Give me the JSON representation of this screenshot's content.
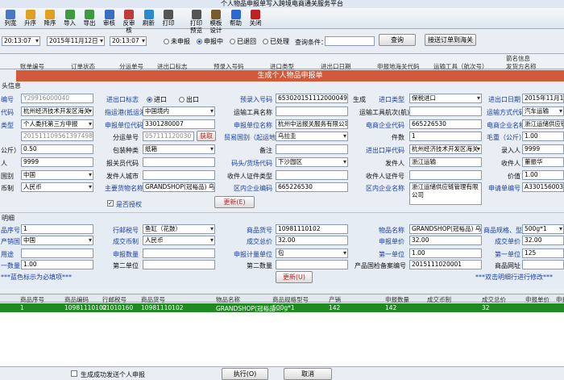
{
  "window": {
    "title": "个人物品申报单写入跨境电商通关服务平台"
  },
  "toolbar": [
    {
      "label": "列宽",
      "icon": "column-width-icon",
      "color": "#4a78c2"
    },
    {
      "label": "升序",
      "icon": "sort-asc-icon",
      "color": "#e0a020"
    },
    {
      "label": "降序",
      "icon": "sort-desc-icon",
      "color": "#e0a020"
    },
    {
      "label": "导入",
      "icon": "import-icon",
      "color": "#3f9a3f"
    },
    {
      "label": "导出",
      "icon": "export-icon",
      "color": "#3f9a3f"
    },
    {
      "label": "审核",
      "icon": "audit-icon",
      "color": "#3a6fc0"
    },
    {
      "label": "反审核",
      "icon": "unaudit-icon",
      "color": "#c03a3a"
    },
    {
      "label": "刷新",
      "icon": "refresh-icon",
      "color": "#2a8ad0"
    },
    {
      "label": "打印",
      "icon": "print-icon",
      "color": "#555"
    },
    {
      "label": "打印预览",
      "icon": "print-preview-icon",
      "color": "#555"
    },
    {
      "label": "模板设计",
      "icon": "template-design-icon",
      "color": "#7a5a2a"
    },
    {
      "label": "帮助",
      "icon": "help-icon",
      "color": "#2a6ad0"
    },
    {
      "label": "关闭",
      "icon": "close-icon",
      "color": "#c02020"
    }
  ],
  "filter": {
    "time1": "20:13:07",
    "date2": "2015年11月12日",
    "time2": "20:13:07",
    "radios": [
      "未申报",
      "申报中",
      "已退回",
      "已处理"
    ],
    "radio_selected": 1,
    "query_label": "查询条件：",
    "query_value": "",
    "query_button": "查询",
    "send_button": "接送订单到海关"
  },
  "grid1": {
    "group_label": "箭名信息",
    "headers": [
      "账单编号",
      "订单状态",
      "分运单号",
      "进出口标志",
      "预录入号码",
      "进口类型",
      "进出口日期",
      "申报地海关代码",
      "运输工具（航次号）",
      "发货方名称"
    ]
  },
  "modal": {
    "title": "生成个人物品申报单"
  },
  "sec1": {
    "heading": "头信息",
    "left": [
      {
        "label": "编号",
        "value": "Y29916000040",
        "gray": true
      },
      {
        "label": "代码",
        "value": "杭州经济技术开发区海关",
        "select": true
      },
      {
        "label": "类型",
        "value": "个人委托第三方申报",
        "select": true
      },
      {
        "label": "",
        "value": "201511109561397498I",
        "gray": true
      },
      {
        "label": "公斤）",
        "value": "0.50"
      },
      {
        "label": "人",
        "value": "9999"
      },
      {
        "label": "国别",
        "value": "中国",
        "select": true
      },
      {
        "label": "币制",
        "value": "人民币",
        "select": true
      }
    ],
    "mid_labels": [
      "进出口标志",
      "指运港(抵运港)",
      "申报单位代码",
      "分运单号",
      "包装种类",
      "报关员代码",
      "发件人城市",
      "主要货物名称"
    ],
    "mid_values": [
      {
        "value": ""
      },
      {
        "value": "中国境内",
        "select": true
      },
      {
        "value": "3301280007"
      },
      {
        "value": "057111120030",
        "gray": true
      },
      {
        "value": "纸箱",
        "select": true
      },
      {
        "value": ""
      },
      {
        "value": ""
      },
      {
        "value": "GRANDSHOP(冠裕品) 乌拉圭"
      }
    ],
    "io_radios": [
      "进口",
      "出口"
    ],
    "get_button": "获取",
    "authorize_label": "是否授权",
    "r1_labels": [
      "预录入号码",
      "运输工具名称",
      "申报单位名称",
      "贸易国别（起运地）",
      "备注",
      "码头/货场代码",
      "收件人证件类型",
      "区内企业编码"
    ],
    "r1_values": [
      {
        "value": "653020151112000049"
      },
      {
        "value": ""
      },
      {
        "value": "杭州中远报关服务有限公司"
      },
      {
        "value": "乌拉圭",
        "select": true
      },
      {
        "value": ""
      },
      {
        "value": "下沙园区",
        "select": true
      },
      {
        "value": ""
      },
      {
        "value": "665226530"
      }
    ],
    "c4_labels": [
      "生成",
      "",
      "",
      "",
      "",
      "",
      "",
      ""
    ],
    "r2_labels": [
      "进口类型",
      "运输工具航次(航)号",
      "电商企业代码",
      "件数",
      "进出口岸代码",
      "发件人",
      "收件人证件号",
      "区内企业名称"
    ],
    "r2_values": [
      {
        "value": "保税进口",
        "select": true
      },
      {
        "value": ""
      },
      {
        "value": "665226530"
      },
      {
        "value": "1"
      },
      {
        "value": "杭州经济技术开发区海关",
        "select": true
      },
      {
        "value": "浙江运输"
      },
      {
        "value": ""
      },
      {
        "value": "浙江运储供应链管理有限公司"
      }
    ],
    "r3_labels": [
      "进出口日期",
      "运输方式代码",
      "电商企业名称",
      "毛重（公斤）",
      "录入人",
      "收件人",
      "价值",
      "申请单编号"
    ],
    "r3_values": [
      {
        "value": "2015年11月12日"
      },
      {
        "value": "汽车运输",
        "select": true
      },
      {
        "value": "浙江运储供应链"
      },
      {
        "value": "1.00"
      },
      {
        "value": "9999"
      },
      {
        "value": "董振华"
      },
      {
        "value": "1.00"
      },
      {
        "value": "A330156003920"
      }
    ],
    "update_button": "更新(E)"
  },
  "sec2": {
    "heading": "明细",
    "left": [
      {
        "label": "品序号",
        "value": "1"
      },
      {
        "label": "产销国",
        "value": "中国",
        "select": true
      },
      {
        "label": "用途",
        "value": ""
      },
      {
        "label": "一数量",
        "value": "1.00"
      }
    ],
    "c2_labels": [
      "行邮税号",
      "成交币制",
      "申报数量",
      "第二单位"
    ],
    "c2_values": [
      {
        "value": "鱼缸（花鼓）",
        "select": true
      },
      {
        "value": "人民币",
        "select": true
      },
      {
        "value": ""
      },
      {
        "value": ""
      }
    ],
    "c3_labels": [
      "商品货号",
      "成交总价",
      "申报计量单位",
      "第二数量"
    ],
    "c3_values": [
      {
        "value": "10981110102"
      },
      {
        "value": "32.00"
      },
      {
        "value": "包",
        "select": true
      },
      {
        "value": ""
      }
    ],
    "c4_labels": [
      "物品名称",
      "申报单价",
      "第一单位",
      "产品国检备案编号"
    ],
    "c4_values": [
      {
        "value": "GRANDSHOP(冠裕品) 乌拉圭"
      },
      {
        "value": "32.00"
      },
      {
        "value": "1.00"
      },
      {
        "value": "2015111020001"
      }
    ],
    "c5_labels": [
      "商品规格、型号",
      "成交单价",
      "第一单位",
      "商品网址"
    ],
    "c5_values": [
      {
        "value": "500g*1",
        "select": true
      },
      {
        "value": "32.00"
      },
      {
        "value": "125"
      },
      {
        "value": ""
      }
    ],
    "note_left": "***蓝色标示为必填项***",
    "note_right": "***双击明细行进行修改***",
    "update_button": "更新(U)"
  },
  "grid2": {
    "headers": [
      "商品序号",
      "商品编码",
      "行邮税号",
      "商品货号",
      "物品名称",
      "商品规格型号",
      "产销",
      "申报数量",
      "成交币制",
      "成交总价",
      "申报单价",
      "申报"
    ],
    "row": [
      "1",
      "10981110102",
      "01010160",
      "10981110102",
      "GRANDSHOP(冠裕品...",
      "500g*1",
      "142",
      "142",
      "",
      "32",
      "",
      ""
    ]
  },
  "footer": {
    "check_label": "生成成功发送个人申报",
    "exec_button": "执行(O)",
    "cancel_button": "取消"
  }
}
